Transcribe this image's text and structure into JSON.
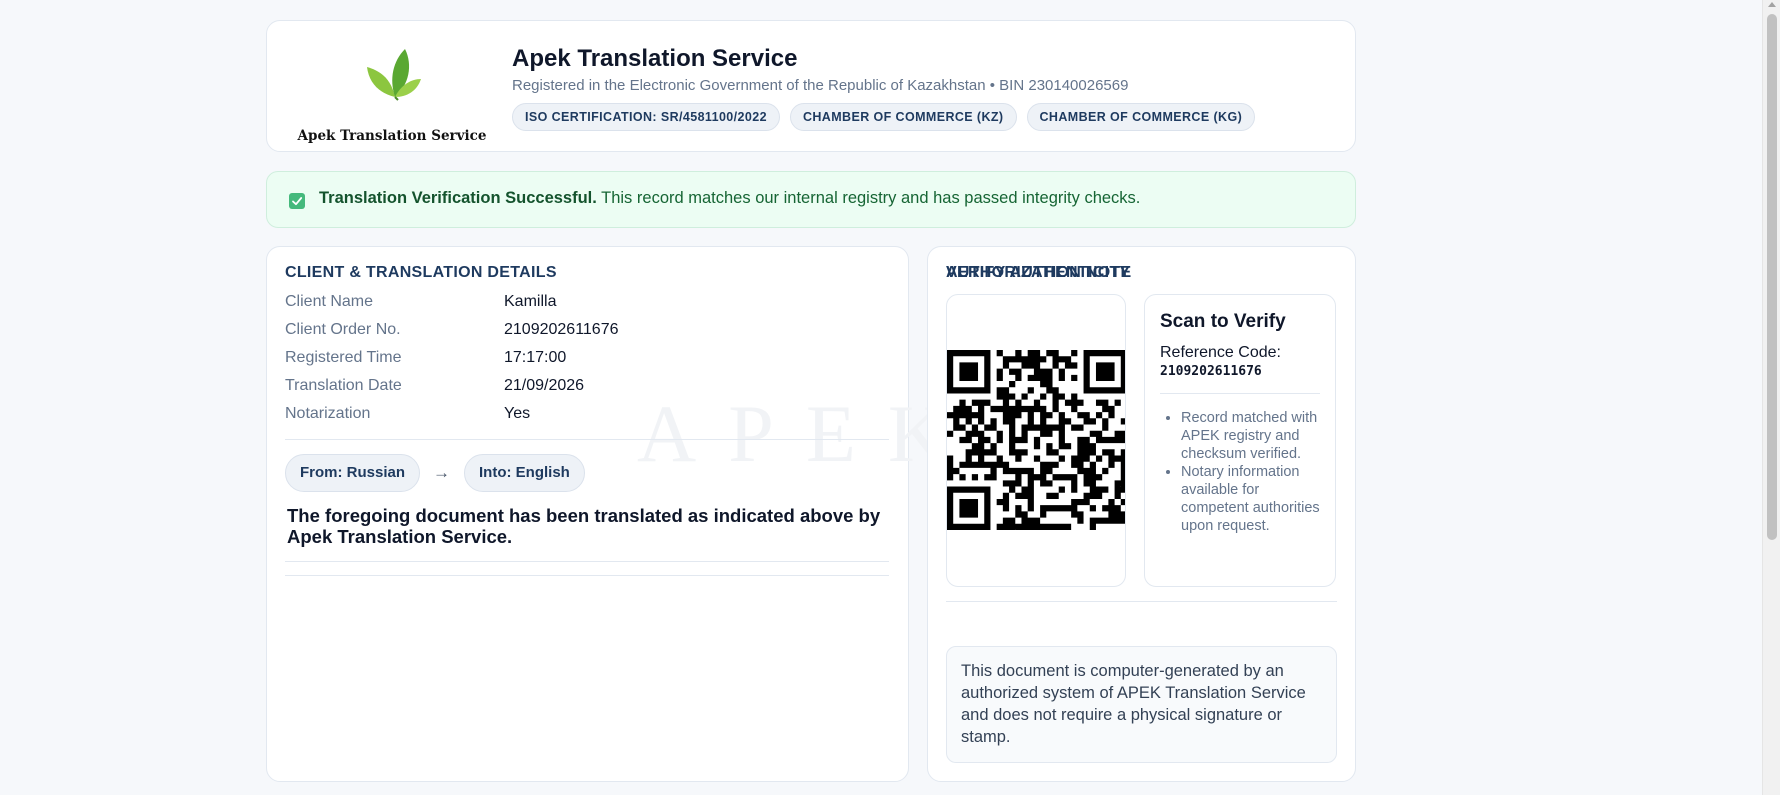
{
  "header": {
    "logo_text": "Apek Translation Service",
    "company_name": "Apek Translation Service",
    "registration_line": "Registered in the Electronic Government of the Republic of Kazakhstan • BIN 230140026569",
    "badges": [
      "ISO CERTIFICATION: SR/4581100/2022",
      "CHAMBER OF COMMERCE (KZ)",
      "CHAMBER OF COMMERCE (KG)"
    ]
  },
  "alert": {
    "title": "Translation Verification Successful.",
    "message": "This record matches our internal registry and has passed integrity checks.",
    "icon": "check-square-icon",
    "color": "#45b97c"
  },
  "details": {
    "title": "CLIENT & TRANSLATION DETAILS",
    "rows": [
      {
        "label": "Client Name",
        "value": "Kamilla"
      },
      {
        "label": "Client Order No.",
        "value": "2109202611676"
      },
      {
        "label": "Registered Time",
        "value": "17:17:00"
      },
      {
        "label": "Translation Date",
        "value": "21/09/2026"
      },
      {
        "label": "Notarization",
        "value": "Yes"
      }
    ],
    "watermark": "APEK",
    "from_language": "From: Russian",
    "arrow": "→",
    "to_language": "Into: English",
    "statement": "The foregoing document has been translated as indicated above by Apek Translation Service."
  },
  "verify": {
    "title": "VERIFY AUTHENTICITY",
    "scan_title": "Scan to Verify",
    "reference_label": "Reference Code:",
    "reference_code": "2109202611676",
    "notes": [
      "Record matched with APEK registry and checksum verified.",
      "Notary information available for competent authorities upon request."
    ],
    "authorization_title": "AUTHORIZATION NOTE",
    "authorization_text": "This document is computer-generated by an authorized system of APEK Translation Service and does not require a physical signature or stamp."
  },
  "colors": {
    "accent": "#1e3a5f",
    "success_bg": "#ecfdf3",
    "success_text": "#166534",
    "logo_green": "#7cc142"
  }
}
